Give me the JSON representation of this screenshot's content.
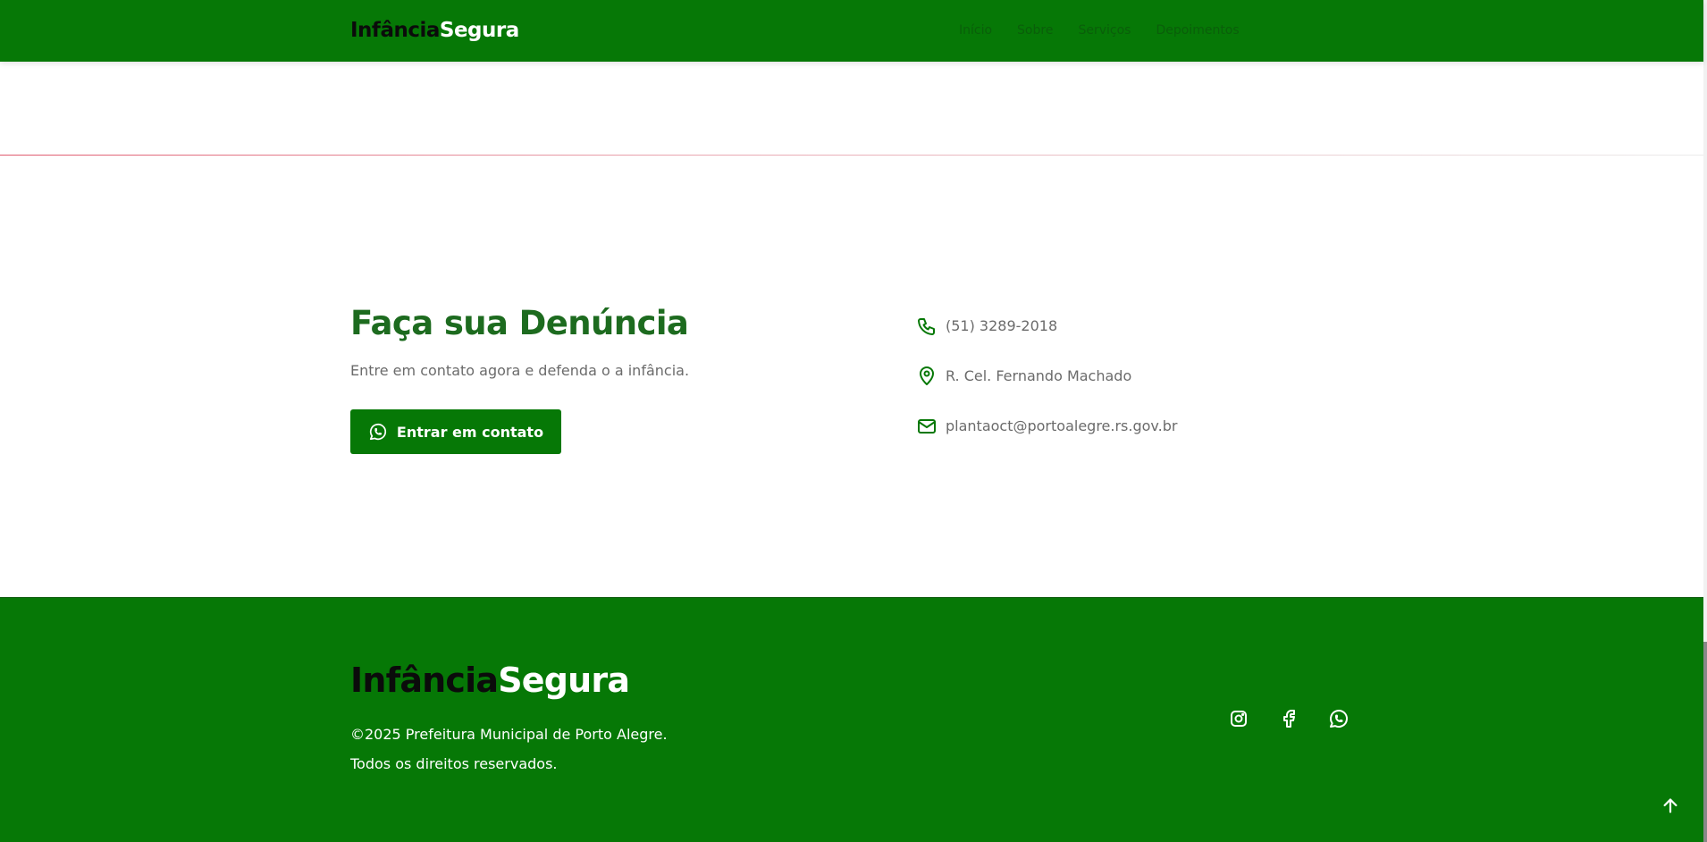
{
  "header": {
    "logo_dark": "Infância",
    "logo_light": "Segura",
    "nav": [
      "Início",
      "Sobre",
      "Serviços",
      "Depoimentos"
    ]
  },
  "contact": {
    "title": "Faça sua Denúncia",
    "subtitle": "Entre em contato agora e defenda o a infância.",
    "button_label": "Entrar em contato",
    "phone": "(51) 3289-2018",
    "address": "R. Cel. Fernando Machado",
    "email": "plantaoct@portoalegre.rs.gov.br"
  },
  "footer": {
    "logo_dark": "Infância",
    "logo_light": "Segura",
    "copyright": "©2025 Prefeitura Municipal de Porto Alegre.",
    "rights": "Todos os direitos reservados.",
    "social": [
      "instagram-icon",
      "facebook-icon",
      "whatsapp-icon"
    ]
  },
  "icons": {
    "phone": "phone-icon",
    "location": "map-pin-icon",
    "email": "mail-icon",
    "button": "whatsapp-icon",
    "back_to_top": "arrow-up-icon"
  },
  "colors": {
    "brand_green": "#067806",
    "title_green": "#1d6b1f",
    "text_gray": "#6b6b6b",
    "divider_accent": "#e05a6e"
  }
}
